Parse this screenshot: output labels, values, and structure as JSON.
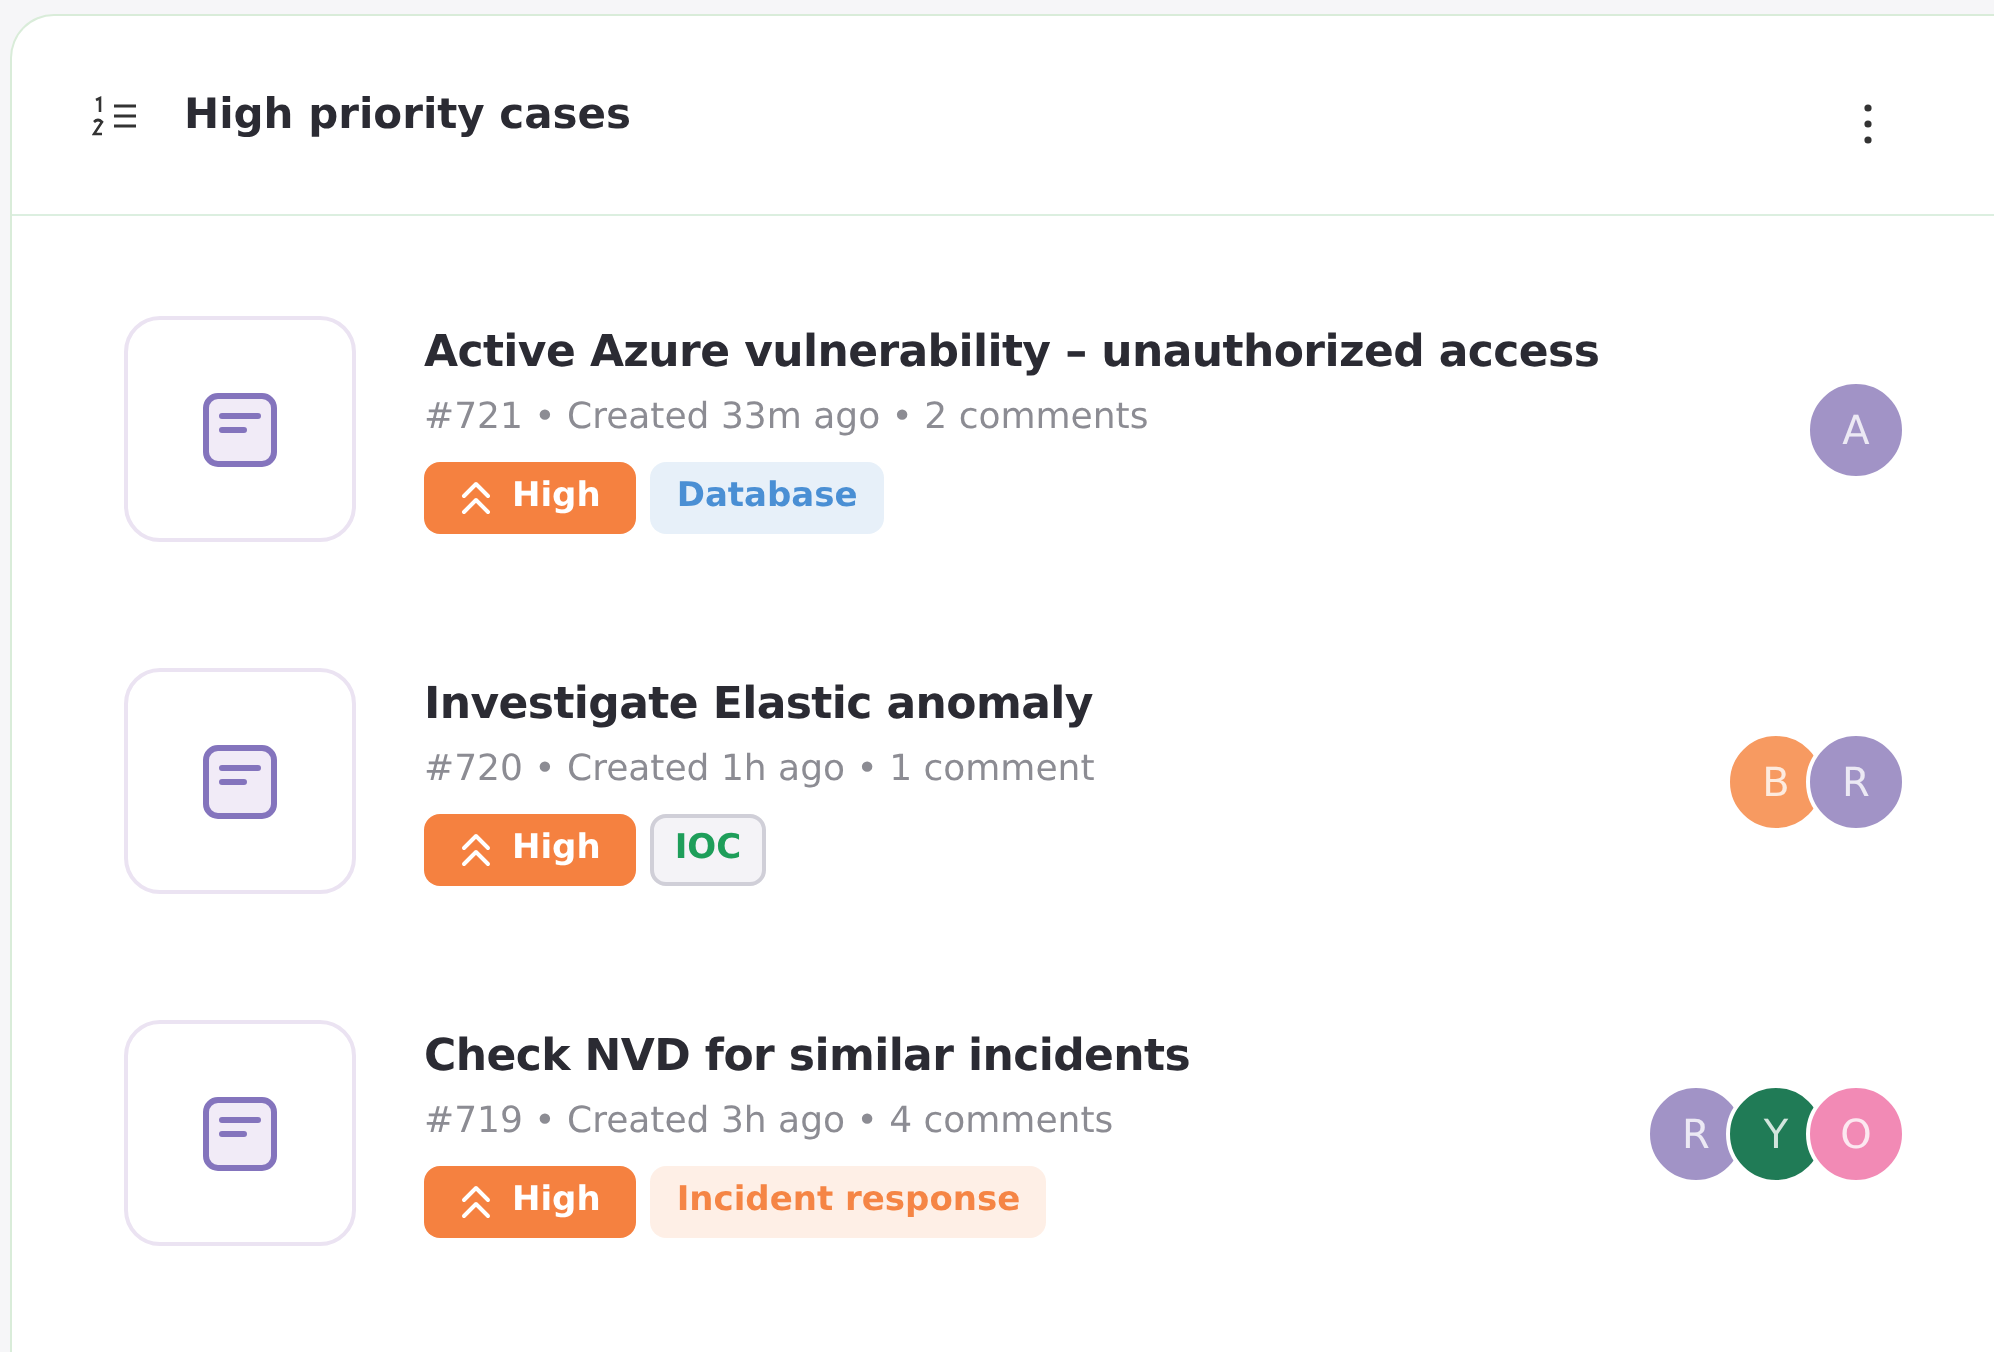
{
  "panel": {
    "title": "High priority cases"
  },
  "cases": [
    {
      "title": "Active Azure vulnerability – unauthorized access",
      "meta": "#721 • Created 33m ago • 2 comments",
      "priority": {
        "kind": "high",
        "label": "High"
      },
      "tags": [
        {
          "label": "Database",
          "kind": "filled",
          "color": "#4a8fd4"
        }
      ],
      "assignees": [
        {
          "initial": "A",
          "color": "#a193c6"
        }
      ]
    },
    {
      "title": "Investigate Elastic anomaly",
      "meta": "#720 • Created 1h ago • 1 comment",
      "priority": {
        "kind": "high",
        "label": "High"
      },
      "tags": [
        {
          "label": "IOC",
          "kind": "outlined",
          "color": "#1e9e5a"
        }
      ],
      "assignees": [
        {
          "initial": "B",
          "color": "#f79a61"
        },
        {
          "initial": "R",
          "color": "#a193c6"
        }
      ]
    },
    {
      "title": "Check NVD for similar incidents",
      "meta": "#719 • Created 3h ago • 4 comments",
      "priority": {
        "kind": "high",
        "label": "High"
      },
      "tags": [
        {
          "label": "Incident response",
          "kind": "filled",
          "color": "#f58545"
        }
      ],
      "assignees": [
        {
          "initial": "R",
          "color": "#a193c6"
        },
        {
          "initial": "Y",
          "color": "#207b56"
        },
        {
          "initial": "O",
          "color": "#f28ab5"
        }
      ]
    }
  ]
}
